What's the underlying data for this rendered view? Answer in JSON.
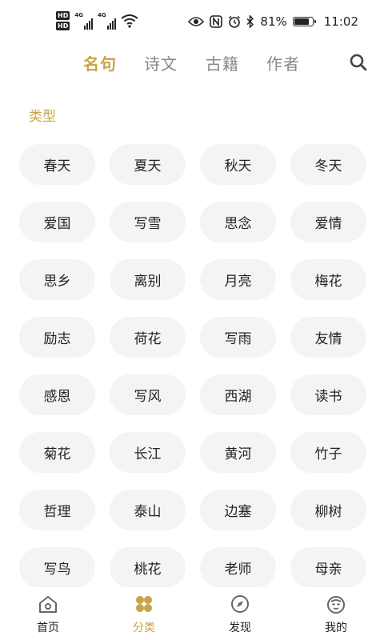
{
  "status_bar": {
    "hd_label": "HD",
    "net_label": "4G",
    "battery_percent": "81%",
    "time": "11:02",
    "icons": [
      "eye-icon",
      "nfc-icon",
      "alarm-icon",
      "bluetooth-icon",
      "battery-icon"
    ]
  },
  "tabs": [
    {
      "label": "名句",
      "active": true
    },
    {
      "label": "诗文",
      "active": false
    },
    {
      "label": "古籍",
      "active": false
    },
    {
      "label": "作者",
      "active": false
    }
  ],
  "section_label": "类型",
  "categories": [
    "春天",
    "夏天",
    "秋天",
    "冬天",
    "爱国",
    "写雪",
    "思念",
    "爱情",
    "思乡",
    "离别",
    "月亮",
    "梅花",
    "励志",
    "荷花",
    "写雨",
    "友情",
    "感恩",
    "写风",
    "西湖",
    "读书",
    "菊花",
    "长江",
    "黄河",
    "竹子",
    "哲理",
    "泰山",
    "边塞",
    "柳树",
    "写鸟",
    "桃花",
    "老师",
    "母亲"
  ],
  "bottom_nav": [
    {
      "label": "首页",
      "icon": "home-icon",
      "active": false
    },
    {
      "label": "分类",
      "icon": "category-icon",
      "active": true
    },
    {
      "label": "发现",
      "icon": "compass-icon",
      "active": false
    },
    {
      "label": "我的",
      "icon": "profile-icon",
      "active": false
    }
  ],
  "colors": {
    "accent": "#c8a447",
    "chip_bg": "#f4f4f4",
    "inactive_tab": "#888888"
  }
}
